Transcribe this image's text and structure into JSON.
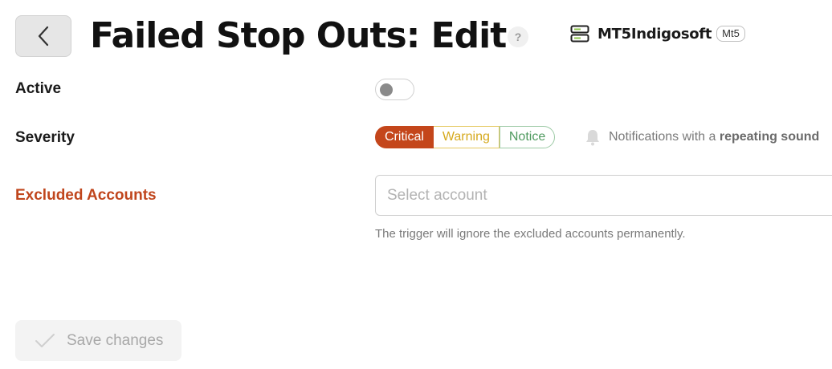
{
  "header": {
    "title": "Failed Stop Outs: Edit",
    "help_glyph": "?",
    "back_icon": "chevron-left-icon",
    "server": {
      "icon": "server-icon",
      "name": "MT5Indigosoft",
      "badge": "Mt5"
    }
  },
  "form": {
    "active": {
      "label": "Active",
      "enabled": false
    },
    "severity": {
      "label": "Severity",
      "options": [
        "Critical",
        "Warning",
        "Notice"
      ],
      "selected": "Critical",
      "note_prefix": "Notifications with a",
      "note_emphasis": "repeating sound",
      "note_icon": "bell-icon"
    },
    "excluded_accounts": {
      "label": "Excluded Accounts",
      "placeholder": "Select account",
      "hint": "The trigger will ignore the excluded accounts permanently."
    }
  },
  "footer": {
    "save_label": "Save changes",
    "save_icon": "check-icon",
    "save_enabled": false
  },
  "colors": {
    "critical": "#c4461b",
    "warning": "#d6a91c",
    "notice": "#4f9a5f",
    "label_warning": "#c0461d",
    "server_icon_accent": "#8bc34a"
  }
}
